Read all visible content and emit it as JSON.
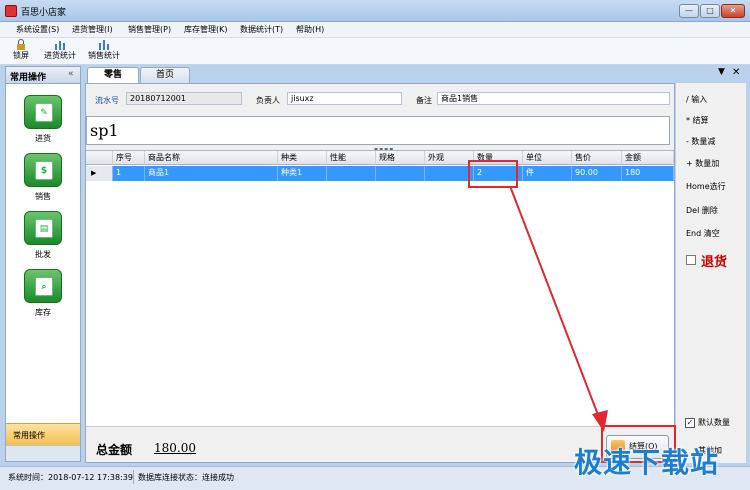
{
  "window": {
    "title": "百思小店家",
    "min": "—",
    "max": "□",
    "close": "✕"
  },
  "menu": [
    "系统设置(S)",
    "进货管理(I)",
    "销售管理(P)",
    "库存管理(K)",
    "数据统计(T)",
    "帮助(H)"
  ],
  "toolbar": {
    "lock": "锁屏",
    "purchase_stats": "进货统计",
    "sales_stats": "销售统计"
  },
  "sidebar": {
    "title": "常用操作",
    "collapse": "«",
    "items": [
      {
        "label": "进货"
      },
      {
        "label": "销售"
      },
      {
        "label": "批发"
      },
      {
        "label": "库存"
      }
    ],
    "bottom": "常用操作"
  },
  "tabs": {
    "retail": "零售",
    "home": "首页",
    "menu": "▼",
    "close": "✕"
  },
  "form": {
    "serial_label": "流水号",
    "serial_value": "20180712001",
    "owner_label": "负责人",
    "owner_value": "jisuxz",
    "note_label": "备注",
    "note_value": "商品1销售",
    "search_value": "sp1"
  },
  "grid": {
    "columns": [
      "序号",
      "商品名称",
      "种类",
      "性能",
      "规格",
      "外观",
      "数量",
      "单位",
      "售价",
      "金额"
    ],
    "rows": [
      {
        "no": "1",
        "name": "商品1",
        "type": "种类1",
        "perf": "",
        "spec": "",
        "look": "",
        "qty": "2",
        "unit": "件",
        "price": "90.00",
        "amount": "180"
      }
    ]
  },
  "total": {
    "label": "总金额",
    "value": "180.00"
  },
  "checkout": "结算(O)",
  "shortcuts": [
    "/  输入",
    "*  结算",
    "-  数量减",
    "+  数量加",
    "Home选行",
    "Del 删除",
    "End 清空"
  ],
  "return_label": "退货",
  "default_qty": "默认数量",
  "other_label": "其他加",
  "status": {
    "time": "系统时间：2018-07-12 17:38:39",
    "db": "数据库连接状态：连接成功"
  },
  "watermark": "极速下载站",
  "colors": {
    "selection": "#3399ff",
    "annotation": "#e0282e",
    "watermark": "#1b7fd1"
  }
}
